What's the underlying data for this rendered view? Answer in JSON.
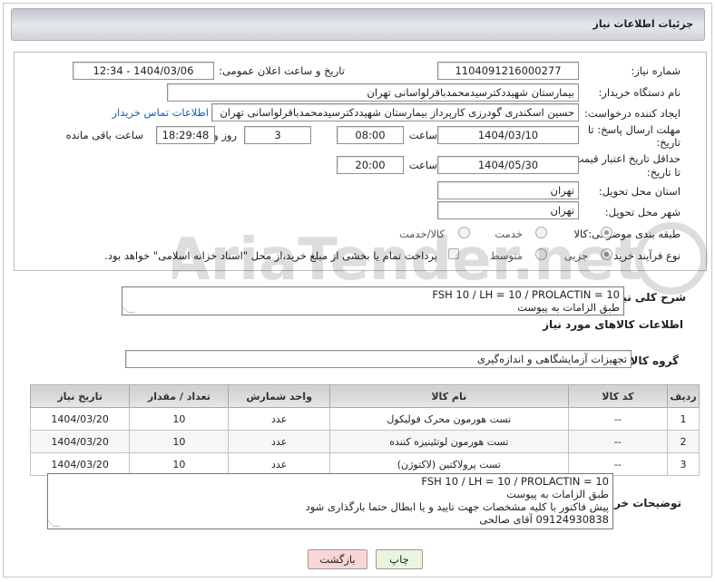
{
  "header": {
    "title": "جزئیات اطلاعات نیاز"
  },
  "form": {
    "need_number_label": "شماره نیاز:",
    "need_number": "1104091216000277",
    "announce_label": "تاریخ و ساعت اعلان عمومی:",
    "announce_value": "1404/03/06 - 12:34",
    "buyer_org_label": "نام دستگاه خریدار:",
    "buyer_org": "بیمارستان شهیددکترسیدمحمدباقرلواسانی تهران",
    "requester_label": "ایجاد کننده درخواست:",
    "requester": "حسین اسکندری گودرزی کارپرداز بیمارستان شهیددکترسیدمحمدباقرلواسانی تهران",
    "contact_link": "اطلاعات تماس خریدار",
    "reply_deadline_label_1": "مهلت ارسال پاسخ: تا",
    "reply_deadline_label_2": "تاریخ:",
    "reply_date": "1404/03/10",
    "time_label": "ساعت",
    "reply_time": "08:00",
    "days_value": "3",
    "days_label": "روز و",
    "remaining_time": "18:29:48",
    "remaining_label": "ساعت باقی مانده",
    "price_validity_label_1": "حداقل تاریخ اعتبار قیمت:",
    "price_validity_label_2": "تا تاریخ:",
    "price_date": "1404/05/30",
    "price_time": "20:00",
    "province_label": "استان محل تحویل:",
    "province": "تهران",
    "city_label": "شهر محل تحویل:",
    "city": "تهران",
    "category_label": "طبقه بندی موضوعی:",
    "category_options": [
      "کالا",
      "خدمت",
      "کالا/خدمت"
    ],
    "purchase_type_label": "نوع فرآیند خرید :",
    "purchase_options": [
      "جزیی",
      "متوسط"
    ],
    "payment_note": "پرداخت تمام یا بخشی از مبلغ خرید،از محل \"اسناد خزانه اسلامی\" خواهد بود."
  },
  "summary": {
    "label": "شرح کلی نیاز:",
    "lines": [
      "FSH 10 / LH = 10 / PROLACTIN = 10",
      "طبق الزامات به پیوست"
    ]
  },
  "goods": {
    "section_title": "اطلاعات کالاهای مورد نیاز",
    "group_label": "گروه کالا:",
    "group_value": "تجهیزات آزمایشگاهی و اندازه‌گیری",
    "columns": [
      "ردیف",
      "کد کالا",
      "نام کالا",
      "واحد شمارش",
      "تعداد / مقدار",
      "تاریخ نیاز"
    ],
    "rows": [
      [
        "1",
        "--",
        "تست هورمون محرک فولیکول",
        "عدد",
        "10",
        "1404/03/20"
      ],
      [
        "2",
        "--",
        "تست هورمون لوتئینیزه کننده",
        "عدد",
        "10",
        "1404/03/20"
      ],
      [
        "3",
        "--",
        "تست پرولاکتین (لاکتوژن)",
        "عدد",
        "10",
        "1404/03/20"
      ]
    ]
  },
  "buyer_notes": {
    "label": "توضیحات خریدار:",
    "lines": [
      "FSH 10 / LH = 10 / PROLACTIN = 10",
      "طبق الزامات به پیوست",
      "پیش فاکتور با کلیه مشخصات جهت تایید و یا ابطال حتما بارگذاری شود",
      "09124930838 آقای صالحی"
    ]
  },
  "buttons": {
    "print": "چاپ",
    "back": "بازگشت"
  },
  "colors": {
    "link": "#1a5ea8",
    "back_button": "#f9d6d6",
    "print_button": "#e9f5e0"
  }
}
